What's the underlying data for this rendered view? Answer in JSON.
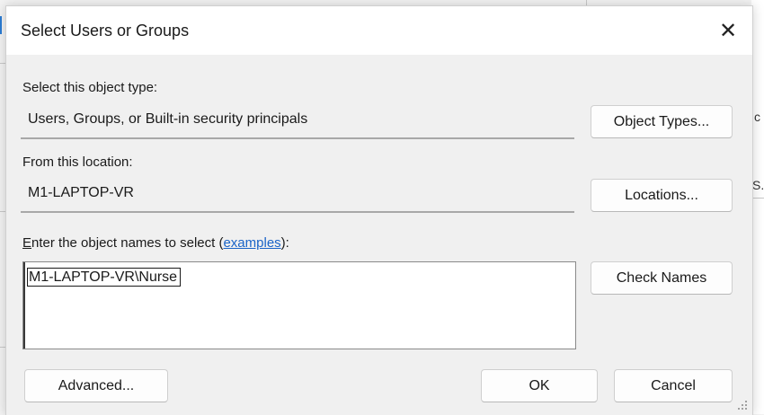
{
  "dialog": {
    "title": "Select Users or Groups",
    "close_glyph": "✕"
  },
  "object_type": {
    "label": "Select this object type:",
    "value": "Users, Groups, or Built-in security principals",
    "button": "Object Types..."
  },
  "location": {
    "label": "From this location:",
    "value": "M1-LAPTOP-VR",
    "button": "Locations..."
  },
  "names": {
    "label_key": "E",
    "label_rest": "nter the object names to select (",
    "label_link": "examples",
    "label_end": "):",
    "value": "M1-LAPTOP-VR\\Nurse",
    "button": "Check Names"
  },
  "footer": {
    "advanced": "Advanced...",
    "ok": "OK",
    "cancel": "Cancel"
  },
  "background": {
    "glyph_c": "c",
    "glyph_s": "S."
  }
}
